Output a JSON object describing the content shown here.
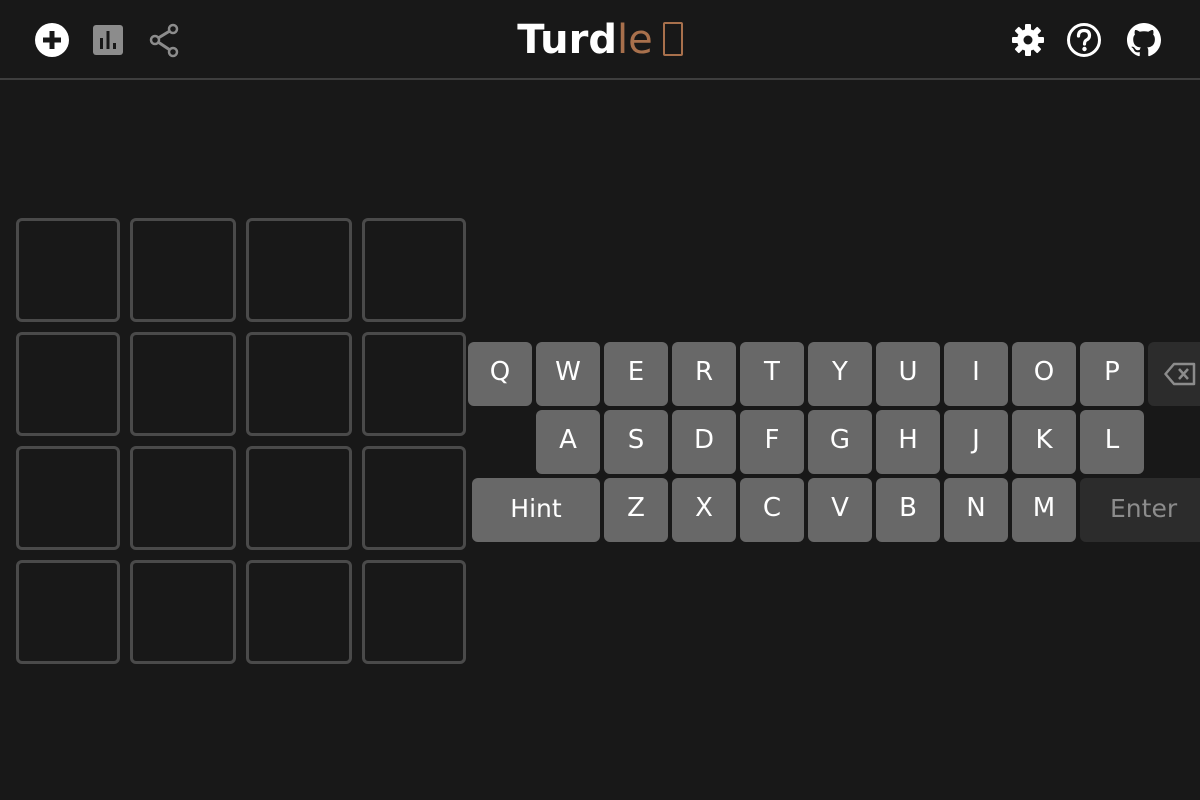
{
  "header": {
    "title_bold": "Turd",
    "title_light": "le",
    "left_icons": [
      "plus-circle-icon",
      "bar-chart-icon",
      "share-icon"
    ],
    "right_icons": [
      "gear-icon",
      "help-icon",
      "github-icon"
    ]
  },
  "board": {
    "rows": 4,
    "cols": 4
  },
  "keyboard": {
    "row1": [
      "Q",
      "W",
      "E",
      "R",
      "T",
      "Y",
      "U",
      "I",
      "O",
      "P"
    ],
    "row2": [
      "A",
      "S",
      "D",
      "F",
      "G",
      "H",
      "J",
      "K",
      "L"
    ],
    "row3": [
      "Z",
      "X",
      "C",
      "V",
      "B",
      "N",
      "M"
    ],
    "hint_label": "Hint",
    "enter_label": "Enter",
    "backspace_icon": "backspace-icon"
  },
  "colors": {
    "background": "#181818",
    "tile_border": "#4a4a4a",
    "key": "#686868",
    "key_disabled": "#2c2c2c",
    "brand_accent": "#a8704c"
  }
}
